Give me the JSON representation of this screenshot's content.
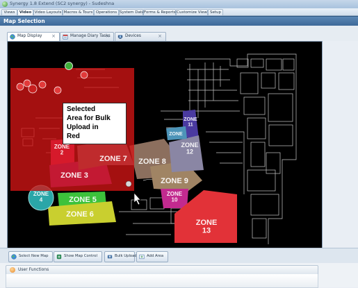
{
  "window": {
    "title": "Synergy 1.8 Extend (SC2 synergy) - Sudeshna"
  },
  "menu": {
    "tabs": [
      {
        "label": "Views"
      },
      {
        "label": "Video"
      },
      {
        "label": "Video Layouts"
      },
      {
        "label": "Macros & Tours"
      },
      {
        "label": "Operations"
      },
      {
        "label": "System Data"
      },
      {
        "label": "Forms & Reports"
      },
      {
        "label": "Customize View"
      },
      {
        "label": "Setup"
      }
    ],
    "active": "Video"
  },
  "section": {
    "title": "Map Selection"
  },
  "map_tabs": [
    {
      "label": "Map Display",
      "icon": "globe-icon"
    },
    {
      "label": "Manage Diary Tasks",
      "icon": "calendar-icon"
    },
    {
      "label": "Devices",
      "icon": "devices-icon"
    }
  ],
  "map": {
    "callout": "Selected\nArea for Bulk\nUpload in\nRed",
    "zones": {
      "z2": {
        "label": "ZONE\n2"
      },
      "z3": {
        "label": "ZONE 3"
      },
      "z4": {
        "label": "ZONE\n4"
      },
      "z5": {
        "label": "ZONE 5"
      },
      "z6": {
        "label": "ZONE 6"
      },
      "z7": {
        "label": "ZONE 7"
      },
      "z8": {
        "label": "ZONE 8"
      },
      "z9": {
        "label": "ZONE 9"
      },
      "z10": {
        "label": "ZONE\n10"
      },
      "z11": {
        "label": "ZONE\n11"
      },
      "z12": {
        "label": "ZONE\n12"
      },
      "z13": {
        "label": "ZONE\n13"
      },
      "z14": {
        "label": "ZONE"
      }
    },
    "colors": {
      "selection": "#d21515",
      "zone2": "#e2307b",
      "zone3": "#8f2c9e",
      "zone4": "#2aa6a8",
      "zone5": "#3cc23b",
      "zone6": "#c9cf2f",
      "zone7": "#7b7b86",
      "zone8": "#8c6f5e",
      "zone9": "#a08464",
      "zone10": "#c22a8f",
      "zone11": "#4a3aa0",
      "zone12": "#8a86a4",
      "zone13": "#e23238",
      "zone14": "#4d94b8"
    }
  },
  "toolbar": {
    "buttons": [
      {
        "label": "Select New Map",
        "icon": "globe-icon"
      },
      {
        "label": "Show Map Control",
        "icon": "control-icon"
      },
      {
        "label": "Bulk Upload",
        "icon": "upload-icon"
      },
      {
        "label": "Add Area",
        "icon": "add-area-icon"
      }
    ]
  },
  "bottom": {
    "user_functions": "User Functions"
  }
}
